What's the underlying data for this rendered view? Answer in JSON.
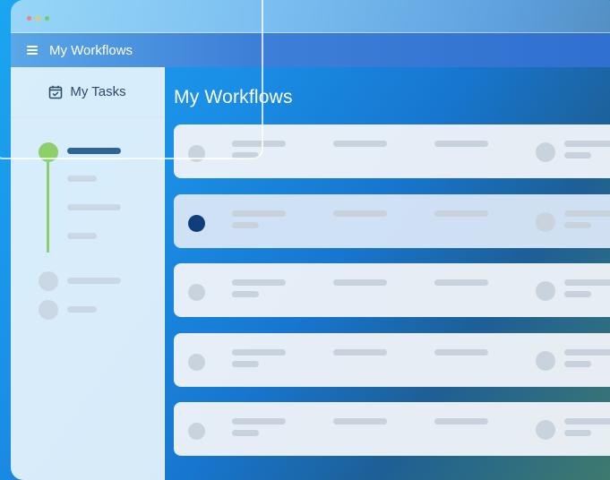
{
  "app": {
    "title": "My Workflows"
  },
  "sidebar": {
    "header_label": "My Tasks",
    "header_icon": "calendar-check-icon"
  },
  "main": {
    "title": "My Workflows"
  },
  "workflow_rows": [
    {
      "selected": false
    },
    {
      "selected": true
    },
    {
      "selected": false
    },
    {
      "selected": false
    },
    {
      "selected": false
    }
  ],
  "colors": {
    "accent_green": "#8fcf6a",
    "selected_dot": "#0f3f7a",
    "active_bar": "#2f6496"
  }
}
